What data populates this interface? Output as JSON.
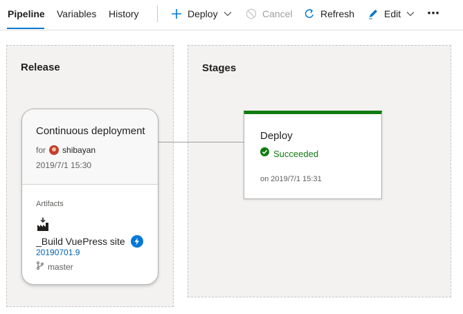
{
  "tabs": [
    {
      "label": "Pipeline"
    },
    {
      "label": "Variables"
    },
    {
      "label": "History"
    }
  ],
  "toolbar": {
    "deploy_label": "Deploy",
    "cancel_label": "Cancel",
    "refresh_label": "Refresh",
    "edit_label": "Edit",
    "more_label": "⋯"
  },
  "release_section": {
    "title": "Release",
    "trigger_title": "Continuous deployment",
    "for_label": "for",
    "user": "shibayan",
    "timestamp": "2019/7/1 15:30",
    "artifacts_label": "Artifacts",
    "artifact_name": "_Build VuePress site",
    "artifact_version": "20190701.9",
    "artifact_branch": "master"
  },
  "stages_section": {
    "title": "Stages",
    "stage_name": "Deploy",
    "stage_status": "Succeeded",
    "stage_time": "on 2019/7/1 15:31"
  },
  "colors": {
    "accent": "#0078d4",
    "success": "#107c10",
    "link": "#0063b1"
  }
}
